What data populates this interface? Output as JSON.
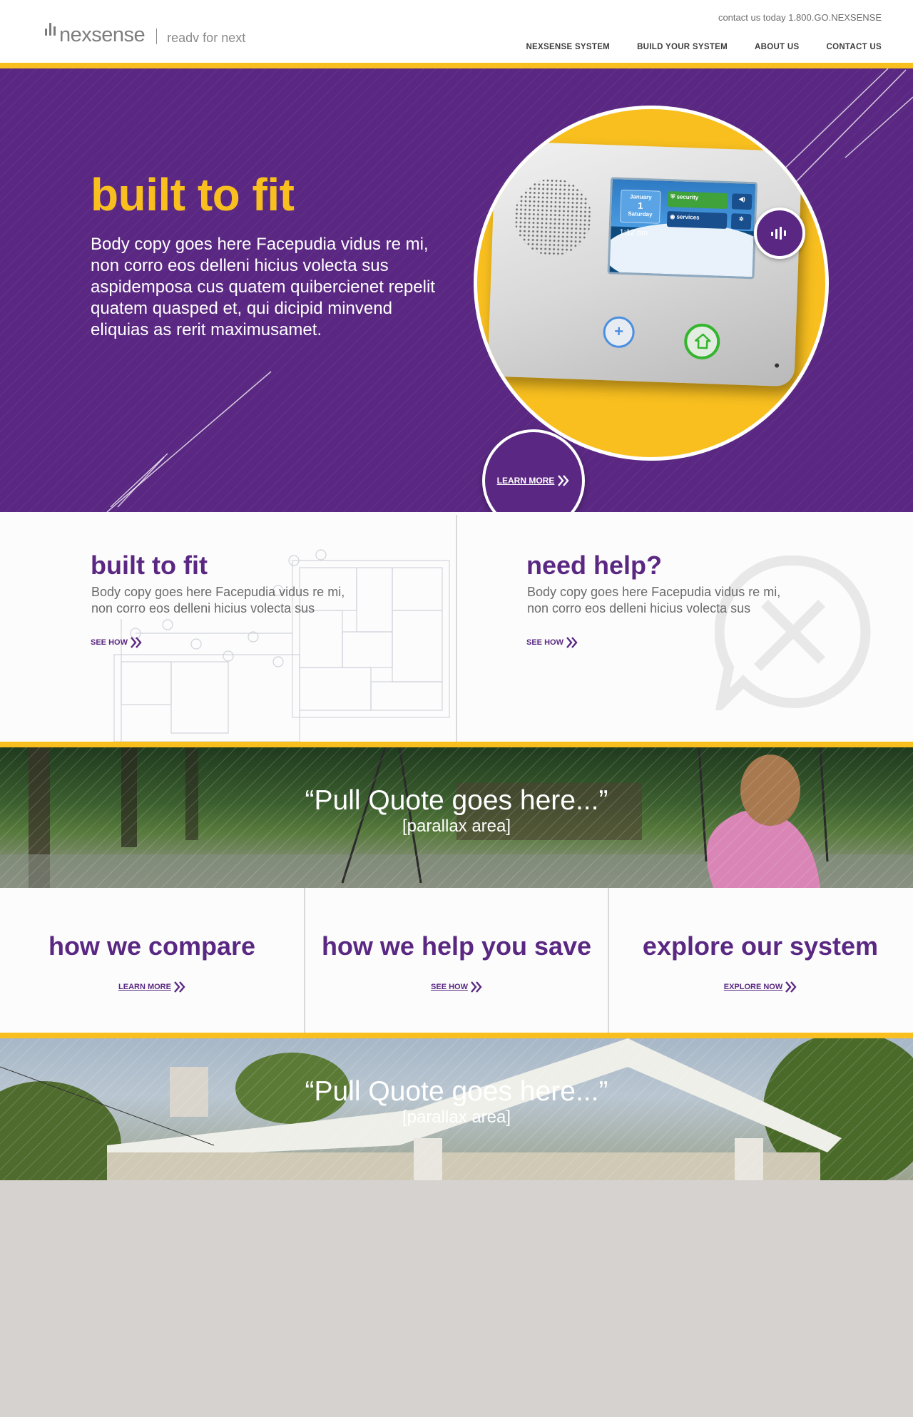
{
  "header": {
    "brand": "nexsense",
    "tagline": "readv for next",
    "contact": "contact us today 1.800.GO.NEXSENSE",
    "nav": [
      "NEXSENSE SYSTEM",
      "BUILD YOUR SYSTEM",
      "ABOUT US",
      "CONTACT US"
    ]
  },
  "hero": {
    "title": "built to fit",
    "body": "Body copy goes here Facepudia vidus re mi, non corro eos delleni hicius volecta sus aspidemposa cus quatem quibercienet repelit quatem quasped et, qui dicipid minvend eliquias as rerit maximusamet.",
    "cta": "LEARN MORE",
    "device": {
      "date_month": "January",
      "date_day": "1",
      "date_weekday": "Saturday",
      "tile_security": "security",
      "tile_services": "services",
      "time": "1:12 am"
    },
    "slides_total": 3,
    "active_slide": 2
  },
  "panels": [
    {
      "title": "built to fit",
      "body": "Body copy goes here Facepudia vidus re mi, non corro eos delleni hicius volecta sus",
      "link": "SEE HOW"
    },
    {
      "title": "need help?",
      "body": "Body copy goes here Facepudia vidus re mi, non corro eos delleni hicius volecta sus",
      "link": "SEE HOW"
    }
  ],
  "quotes": [
    {
      "quote": "“Pull Quote goes here...”",
      "sub": "[parallax area]"
    },
    {
      "quote": "“Pull Quote goes here...”",
      "sub": "[parallax area]"
    }
  ],
  "features": [
    {
      "title": "how we compare",
      "link": "LEARN MORE"
    },
    {
      "title": "how we help you save",
      "link": "SEE HOW"
    },
    {
      "title": "explore our system",
      "link": "EXPLORE NOW"
    }
  ],
  "colors": {
    "brand_purple": "#5a2882",
    "accent_yellow": "#f8bf1f",
    "footer_gray": "#d6d2cf"
  },
  "icons": [
    "nexsense-logo-icon",
    "chevrons-right-icon",
    "help-tools-icon",
    "home-icon",
    "plus-icon",
    "volume-icon",
    "snowflake-icon",
    "shield-icon"
  ]
}
